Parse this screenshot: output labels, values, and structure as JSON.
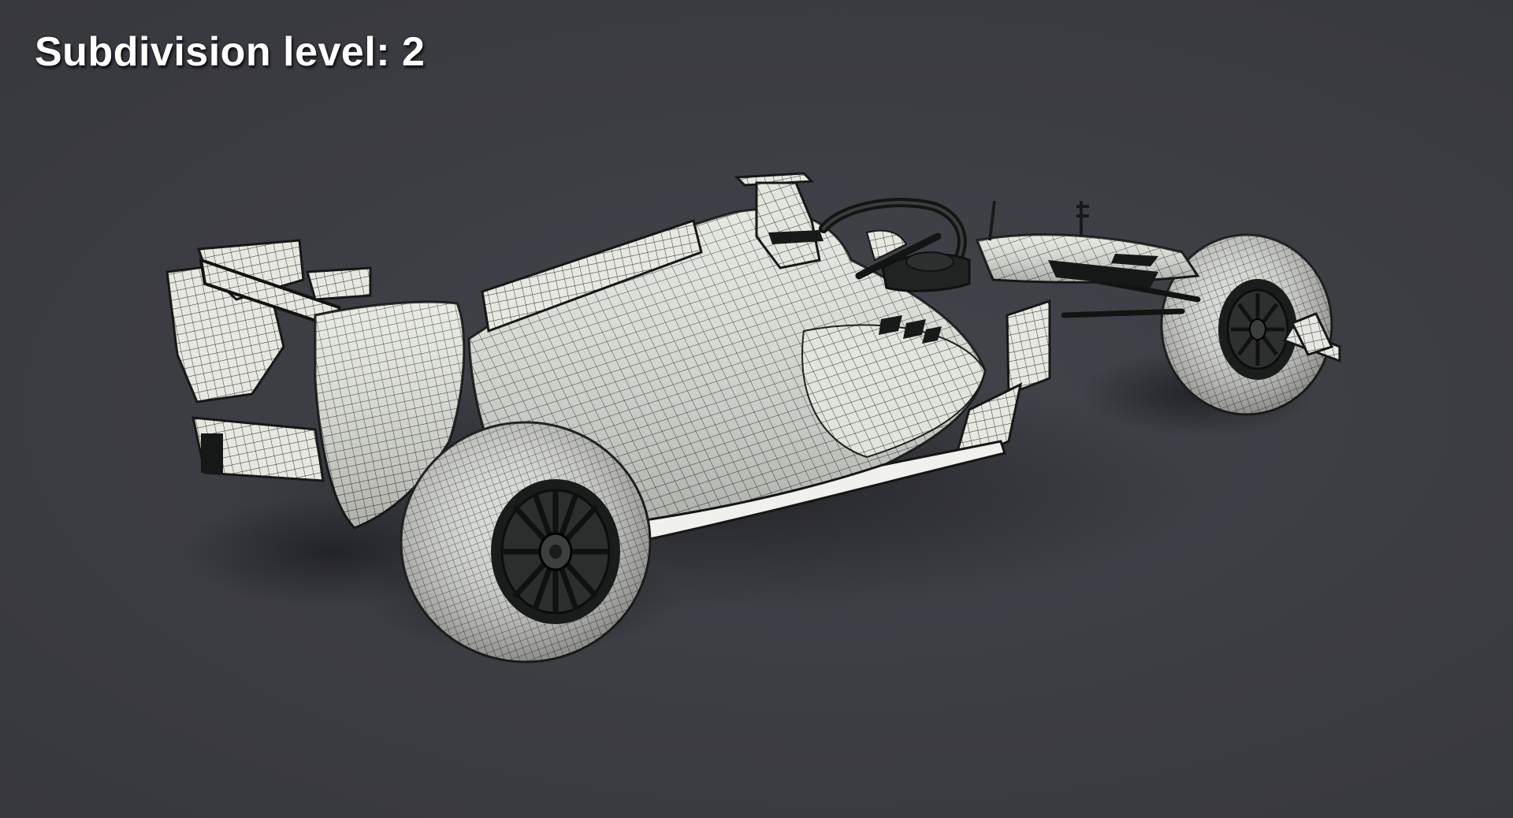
{
  "viewport": {
    "label": "Subdivision level: 2",
    "background_color": "#3c3d43",
    "model_color": "#e4e6df",
    "wire_color": "#1f2322"
  },
  "model": {
    "subject": "formula-one-car-wireframe",
    "shading": "wireframe-on-shaded",
    "subdivision_level": 2
  }
}
